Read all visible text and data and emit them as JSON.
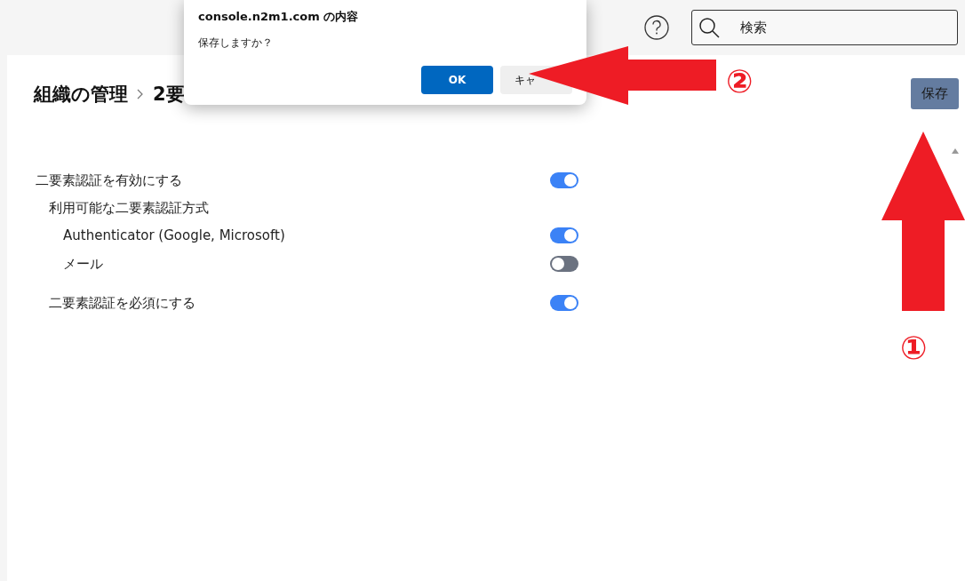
{
  "header": {
    "search": {
      "placeholder": "検索"
    }
  },
  "breadcrumb": [
    "組織の管理",
    "2要"
  ],
  "save_button": "保存",
  "settings": [
    {
      "kind": "toggle",
      "label": "二要素認証を有効にする",
      "on": true
    },
    {
      "kind": "group",
      "label": "利用可能な二要素認証方式",
      "children": [
        {
          "kind": "toggle",
          "label": "Authenticator (Google, Microsoft)",
          "on": true
        },
        {
          "kind": "toggle",
          "label": "メール",
          "on": false
        }
      ]
    },
    {
      "kind": "toggle",
      "label": "二要素認証を必須にする",
      "on": true
    }
  ],
  "dialog": {
    "title": "console.n2m1.com の内容",
    "message": "保存しますか？",
    "buttons": [
      {
        "label": "OK",
        "kind": "primary"
      },
      {
        "label": "キャ",
        "kind": "secondary"
      }
    ]
  },
  "annotations": [
    {
      "number": "①",
      "kind": "up"
    },
    {
      "number": "②",
      "kind": "left"
    }
  ]
}
